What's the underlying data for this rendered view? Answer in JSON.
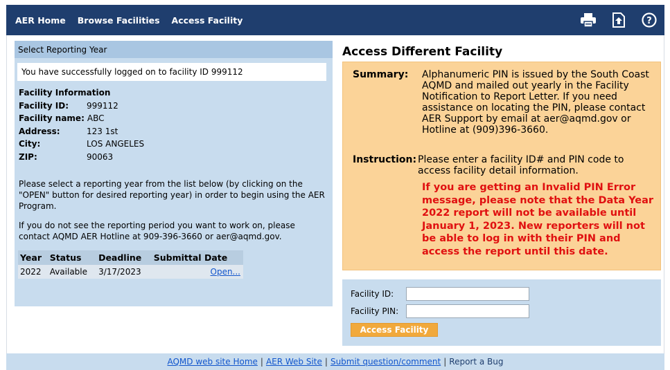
{
  "nav": {
    "links": [
      "AER Home",
      "Browse Facilities",
      "Access Facility"
    ],
    "icons": [
      "printer-icon",
      "upload-icon",
      "help-icon"
    ]
  },
  "left": {
    "header": "Select Reporting Year",
    "login_message": "You have successfully logged on to facility ID 999112",
    "info_title": "Facility Information",
    "fields": [
      {
        "label": "Facility ID:",
        "value": "999112"
      },
      {
        "label": "Facility name:",
        "value": "ABC"
      },
      {
        "label": "Address:",
        "value": "123 1st"
      },
      {
        "label": "City:",
        "value": "LOS ANGELES"
      },
      {
        "label": "ZIP:",
        "value": "90063"
      }
    ],
    "instruction1": "Please select a reporting year from the list below (by clicking on the \"OPEN\" button for desired reporting year) in order to begin using the AER Program.",
    "instruction2": "If you do not see the reporting period you want to work on, please contact AQMD AER Hotline at 909-396-3660 or aer@aqmd.gov.",
    "table": {
      "headers": [
        "Year",
        "Status",
        "Deadline",
        "Submittal Date"
      ],
      "rows": [
        {
          "year": "2022",
          "status": "Available",
          "deadline": "3/17/2023",
          "submittal": "",
          "action": "Open..."
        }
      ]
    }
  },
  "right": {
    "title": "Access Different Facility",
    "summary_label": "Summary:",
    "summary_text": "Alphanumeric PIN is issued by the South Coast AQMD and mailed out yearly in the Facility Notification to Report Letter. If you need assistance on locating the PIN, please contact AER Support by email at aer@aqmd.gov or Hotline at (909)396-3660.",
    "instruction_label": "Instruction:",
    "instruction_text": "Please enter a facility ID# and PIN code to access facility detail information.",
    "warning": "If you are getting an Invalid PIN Error message, please note that the Data Year 2022 report will not be available until January 1, 2023. New reporters will not be able to log in with their PIN and access the report until this date.",
    "facility_id_label": "Facility ID:",
    "facility_pin_label": "Facility PIN:",
    "facility_id_value": "",
    "facility_pin_value": "",
    "button": "Access Facility"
  },
  "footer": {
    "links": [
      "AQMD web site Home",
      "AER Web Site",
      "Submit question/comment",
      "Report a Bug"
    ]
  },
  "colors": {
    "nav_bg": "#1f3e6e",
    "panel_bg": "#c8dcee",
    "summary_bg": "#fbd398",
    "warning": "#e01010",
    "button": "#f1a93c"
  }
}
